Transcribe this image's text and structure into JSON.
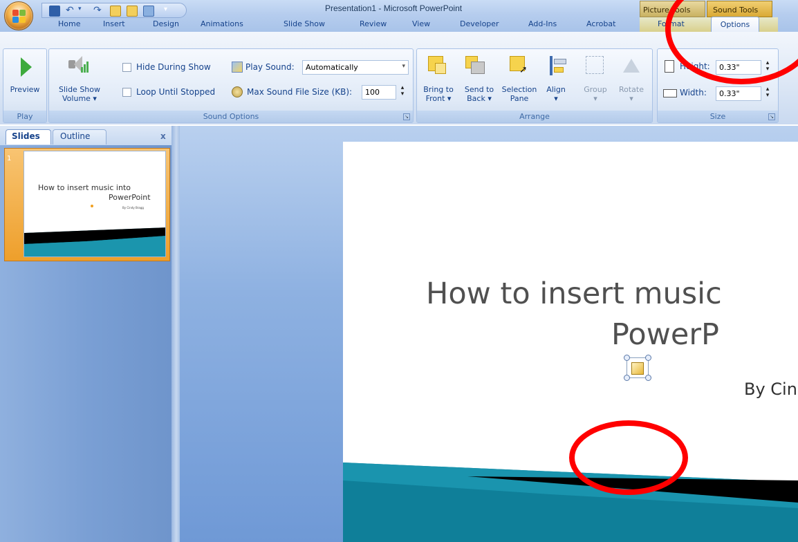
{
  "window": {
    "title": "Presentation1 - Microsoft PowerPoint"
  },
  "context_tabs": {
    "picture_tools": "Picture Tools",
    "sound_tools": "Sound Tools"
  },
  "tabs": [
    "Home",
    "Insert",
    "Design",
    "Animations",
    "Slide Show",
    "Review",
    "View",
    "Developer",
    "Add-Ins",
    "Acrobat",
    "Format",
    "Options"
  ],
  "active_tab": "Options",
  "ribbon": {
    "play": {
      "preview_label": "Preview",
      "group_label": "Play"
    },
    "sound_options": {
      "slide_show_volume": [
        "Slide Show",
        "Volume"
      ],
      "hide_during_show": "Hide During Show",
      "loop_until_stopped": "Loop Until Stopped",
      "play_sound_label": "Play Sound:",
      "play_sound_value": "Automatically",
      "max_size_label": "Max Sound File Size (KB):",
      "max_size_value": "100",
      "group_label": "Sound Options"
    },
    "arrange": {
      "bring_to_front": [
        "Bring to",
        "Front"
      ],
      "send_to_back": [
        "Send to",
        "Back"
      ],
      "selection_pane": [
        "Selection",
        "Pane"
      ],
      "align": "Align",
      "group": "Group",
      "rotate": "Rotate",
      "group_label": "Arrange"
    },
    "size": {
      "height_label": "Height:",
      "height_value": "0.33\"",
      "width_label": "Width:",
      "width_value": "0.33\"",
      "group_label": "Size"
    }
  },
  "slides_pane": {
    "tab_slides": "Slides",
    "tab_outline": "Outline",
    "close": "x",
    "thumbnail": {
      "number": "1",
      "title_line1": "How to insert music into",
      "title_line2": "PowerPoint",
      "byline": "By Cindy Bragg"
    }
  },
  "slide": {
    "title_line1": "How to insert music",
    "title_line2": "PowerP",
    "subtitle": "By Cinc"
  },
  "colors": {
    "accent": "#15428b",
    "annotation": "#ff0000",
    "slide_band": "#1b8aa3"
  }
}
